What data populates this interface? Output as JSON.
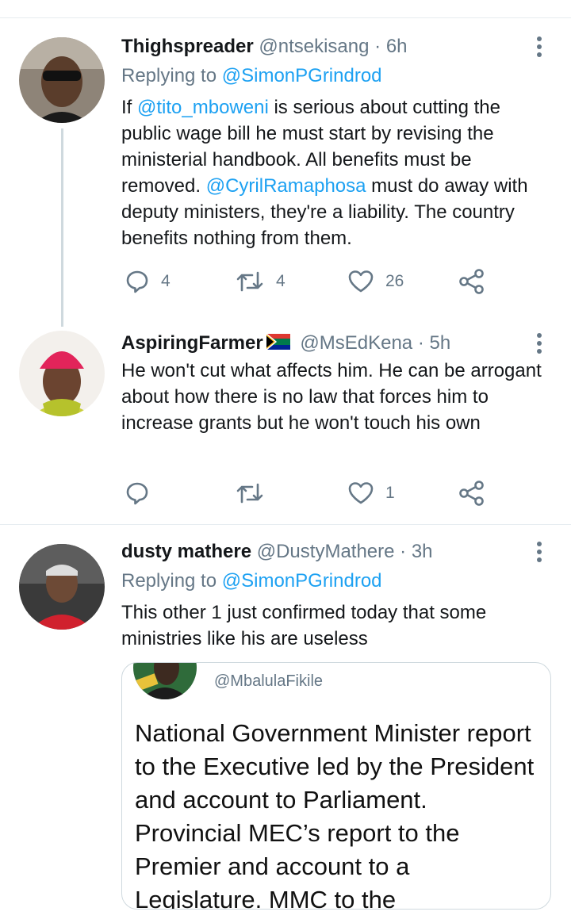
{
  "tweets": [
    {
      "name": "Thighspreader",
      "handle": "@ntsekisang",
      "time": "· 6h",
      "replying_prefix": "Replying to ",
      "replying_to": "@SimonPGrindrod",
      "text": {
        "p1": "If ",
        "m1": "@tito_mboweni",
        "p2": " is serious about cutting the public wage bill he must start by revising the ministerial handbook. All benefits must be removed. ",
        "m2": "@CyrilRamaphosa",
        "p3": " must do away with deputy ministers, they're a liability. The country benefits nothing from them."
      },
      "reply_count": "4",
      "retweet_count": "4",
      "like_count": "26"
    },
    {
      "name": "AspiringFarmer",
      "flag": "south-africa-flag",
      "handle": "@MsEdKena",
      "time": "· 5h",
      "text": "He won't cut what affects him. He can be arrogant about how there is no law that forces him to increase grants but he won't touch his own",
      "like_count": "1"
    },
    {
      "name": "dusty mathere",
      "handle": "@DustyMathere",
      "time": "· 3h",
      "replying_prefix": "Replying to ",
      "replying_to": "@SimonPGrindrod",
      "text": "This other 1 just confirmed today that some ministries like his are useless",
      "quote": {
        "handle": "@MbalulaFikile",
        "text": "National Government Minister report to the Executive led by the President and account to Parliament. Provincial MEC’s report to the Premier and account to a Legislature. MMC to the"
      }
    }
  ],
  "icons": {
    "reply": "reply-icon",
    "retweet": "retweet-icon",
    "like": "heart-icon",
    "share": "share-icon",
    "more": "more-vertical-icon"
  },
  "colors": {
    "link": "#1da1f2",
    "secondary": "#657786",
    "divider": "#e6ecf0"
  }
}
